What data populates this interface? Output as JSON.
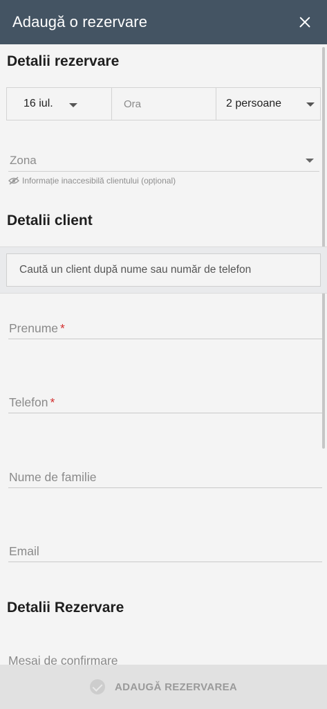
{
  "header": {
    "title": "Adaugă o rezervare",
    "close_icon": "close-icon"
  },
  "reservation_details": {
    "title": "Detalii rezervare",
    "date": "16 iul.",
    "time_placeholder": "Ora",
    "party_size": "2 persoane",
    "zone_label": "Zona",
    "zone_hint": "Informație inaccesibilă clientului (opțional)"
  },
  "client_details": {
    "title": "Detalii client",
    "search_placeholder": "Caută un client după nume sau număr de telefon",
    "first_name_label": "Prenume",
    "phone_label": "Telefon",
    "last_name_label": "Nume de familie",
    "email_label": "Email",
    "required_mark": "*"
  },
  "booking_section": {
    "title": "Detalii Rezervare",
    "confirmation_message_label": "Mesaj de confirmare"
  },
  "footer": {
    "submit_label": "ADAUGĂ REZERVAREA"
  },
  "colors": {
    "header_bg": "#445463",
    "required": "#d32f2f",
    "footer_bg": "#e1e1e1"
  }
}
